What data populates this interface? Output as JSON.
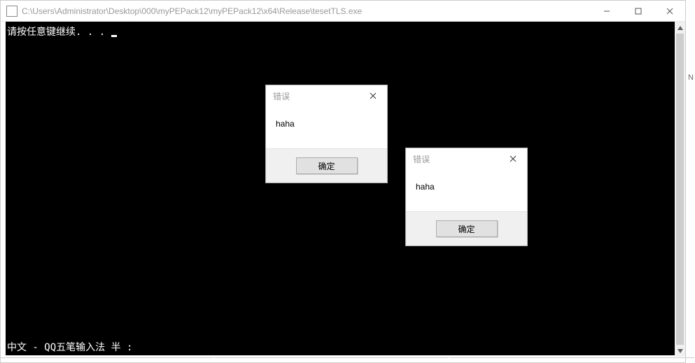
{
  "window": {
    "title": "C:\\Users\\Administrator\\Desktop\\000\\myPEPack12\\myPEPack12\\x64\\Release\\tesetTLS.exe"
  },
  "console": {
    "line1": "请按任意键继续. . . ",
    "ime_status": "中文 - QQ五笔输入法 半 :"
  },
  "dialogs": [
    {
      "title": "错误",
      "message": "haha",
      "ok_label": "确定"
    },
    {
      "title": "错误",
      "message": "haha",
      "ok_label": "确定"
    }
  ],
  "right_hint": "N"
}
